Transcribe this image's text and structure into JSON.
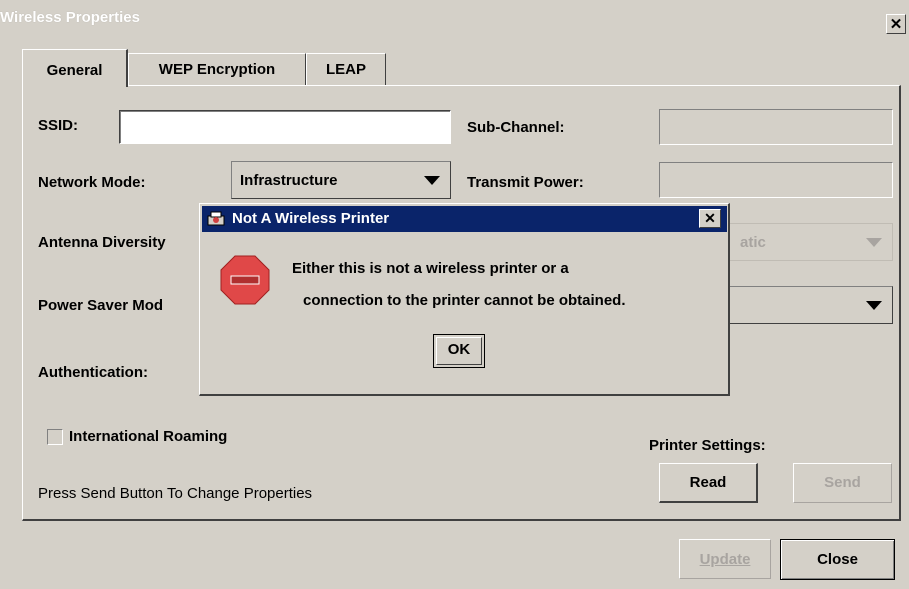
{
  "window": {
    "title": "Wireless Properties",
    "close_glyph": "✕"
  },
  "tabs": [
    {
      "label": "General",
      "active": true
    },
    {
      "label": "WEP Encryption",
      "active": false
    },
    {
      "label": "LEAP",
      "active": false
    }
  ],
  "form": {
    "ssid_label": "SSID:",
    "ssid_value": "",
    "subchannel_label": "Sub-Channel:",
    "subchannel_value": "",
    "network_mode_label": "Network Mode:",
    "network_mode_value": "Infrastructure",
    "transmit_power_label": "Transmit Power:",
    "transmit_power_value": "",
    "antenna_diversity_label": "Antenna Diversity",
    "antenna_value_partial": "atic",
    "power_saver_label": "Power Saver Mod",
    "authentication_label": "Authentication:",
    "international_roaming_label": "International Roaming",
    "international_roaming_checked": false,
    "printer_settings_label": "Printer Settings:",
    "read_label": "Read",
    "send_label": "Send",
    "status_text": "Press Send Button To Change Properties"
  },
  "footer": {
    "update_label": "Update",
    "close_label": "Close"
  },
  "dialog": {
    "title": "Not A Wireless Printer",
    "line1": "Either this is not a wireless printer or a",
    "line2": "connection to the printer cannot be obtained.",
    "ok_label": "OK",
    "close_glyph": "✕"
  },
  "colors": {
    "window_bg": "#d4d0c8",
    "dialog_title_bg": "#0a246a",
    "stop_icon": "#e04040",
    "disabled_text": "#a8a4a0"
  }
}
